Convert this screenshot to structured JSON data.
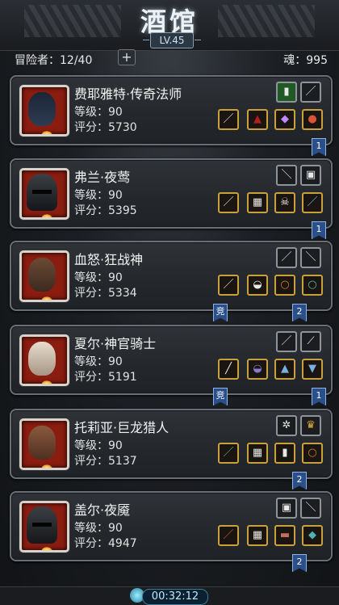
{
  "header": {
    "title": "酒馆",
    "level_badge": "LV.45"
  },
  "stats": {
    "adventurers_label": "冒险者：12/40",
    "add_symbol": "+",
    "soul_label": "魂：995"
  },
  "heroes": [
    {
      "name": "费耶雅特·传奇法师",
      "level": "等级：90",
      "score": "评分：5730",
      "portrait_color": "#1f2a3a",
      "ribbons": [
        "1"
      ]
    },
    {
      "name": "弗兰·夜莺",
      "level": "等级：90",
      "score": "评分：5395",
      "portrait_color": "#2a2c30",
      "ribbons": [
        "1"
      ]
    },
    {
      "name": "血怒·狂战神",
      "level": "等级：90",
      "score": "评分：5334",
      "portrait_color": "#5a3a28",
      "ribbons": [
        "竞",
        "2"
      ]
    },
    {
      "name": "夏尔·神官骑士",
      "level": "等级：90",
      "score": "评分：5191",
      "portrait_color": "#c9b9a8",
      "ribbons": [
        "竞",
        "1"
      ]
    },
    {
      "name": "托莉亚·巨龙猎人",
      "level": "等级：90",
      "score": "评分：5137",
      "portrait_color": "#5b3a2a",
      "ribbons": [
        "2"
      ]
    },
    {
      "name": "盖尔·夜魇",
      "level": "等级：90",
      "score": "评分：4947",
      "portrait_color": "#2a2c30",
      "ribbons": [
        "2"
      ]
    }
  ],
  "footer": {
    "timer": "00:32:12"
  }
}
